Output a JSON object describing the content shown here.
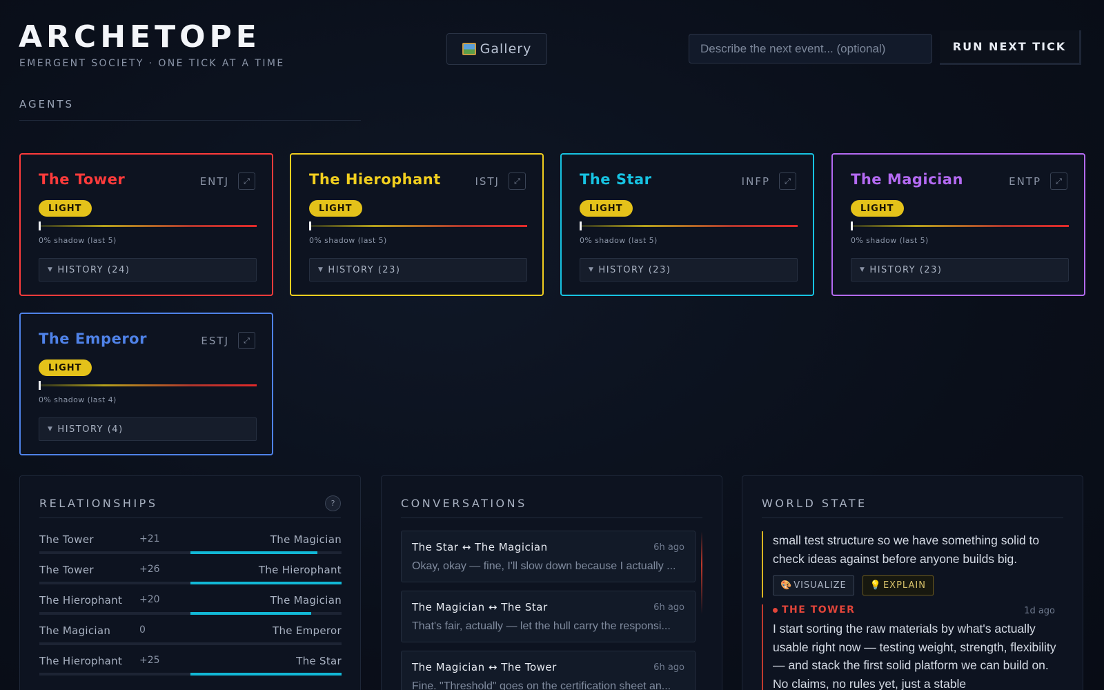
{
  "header": {
    "logo": "ARCHETOPE",
    "tagline": "EMERGENT SOCIETY · ONE TICK AT A TIME",
    "gallery_label": "Gallery",
    "gallery_icon": "framed-picture-icon",
    "event_placeholder": "Describe the next event... (optional)",
    "run_label": "RUN NEXT TICK"
  },
  "agents_section": {
    "label": "AGENTS"
  },
  "agents": [
    {
      "name": "The Tower",
      "type": "ENTJ",
      "color": "#ff3b3b",
      "badge": "LIGHT",
      "shadow_pct": 0,
      "shadow_text": "0% shadow (last 5)",
      "history_label": "HISTORY (24)"
    },
    {
      "name": "The Hierophant",
      "type": "ISTJ",
      "color": "#f2cf1f",
      "badge": "LIGHT",
      "shadow_pct": 0,
      "shadow_text": "0% shadow (last 5)",
      "history_label": "HISTORY (23)"
    },
    {
      "name": "The Star",
      "type": "INFP",
      "color": "#17c3e2",
      "badge": "LIGHT",
      "shadow_pct": 0,
      "shadow_text": "0% shadow (last 5)",
      "history_label": "HISTORY (23)"
    },
    {
      "name": "The Magician",
      "type": "ENTP",
      "color": "#b46af2",
      "badge": "LIGHT",
      "shadow_pct": 0,
      "shadow_text": "0% shadow (last 5)",
      "history_label": "HISTORY (23)"
    },
    {
      "name": "The Emperor",
      "type": "ESTJ",
      "color": "#4f82e8",
      "badge": "LIGHT",
      "shadow_pct": 0,
      "shadow_text": "0% shadow (last 4)",
      "history_label": "HISTORY (4)"
    }
  ],
  "relationships": {
    "title": "RELATIONSHIPS",
    "help_icon": "?",
    "rows": [
      {
        "a": "The Tower",
        "score": "+21",
        "b": "The Magician",
        "value": 21
      },
      {
        "a": "The Tower",
        "score": "+26",
        "b": "The Hierophant",
        "value": 26
      },
      {
        "a": "The Hierophant",
        "score": "+20",
        "b": "The Magician",
        "value": 20
      },
      {
        "a": "The Magician",
        "score": "0",
        "b": "The Emperor",
        "value": 0
      },
      {
        "a": "The Hierophant",
        "score": "+25",
        "b": "The Star",
        "value": 25
      }
    ]
  },
  "conversations": {
    "title": "CONVERSATIONS",
    "items": [
      {
        "title": "The Star ↔ The Magician",
        "time": "6h ago",
        "snippet": "Okay, okay — fine, I'll slow down because I actually ..."
      },
      {
        "title": "The Magician ↔ The Star",
        "time": "6h ago",
        "snippet": "That's fair, actually — let the hull carry the responsi..."
      },
      {
        "title": "The Magician ↔ The Tower",
        "time": "6h ago",
        "snippet": "Fine. \"Threshold\" goes on the certification sheet an..."
      }
    ]
  },
  "world_state": {
    "title": "WORLD STATE",
    "entry1_text": "small test structure so we have something solid to check ideas against before anyone builds big.",
    "visualize_label": "VISUALIZE",
    "visualize_icon": "palette-icon",
    "explain_label": "EXPLAIN",
    "explain_icon": "lightbulb-icon",
    "entry2_speaker": "THE TOWER",
    "entry2_time": "1d ago",
    "entry2_text": "I start sorting the raw materials by what's actually usable right now — testing weight, strength, flexibility — and stack the first solid platform we can build on. No claims, no rules yet, just a stable"
  }
}
